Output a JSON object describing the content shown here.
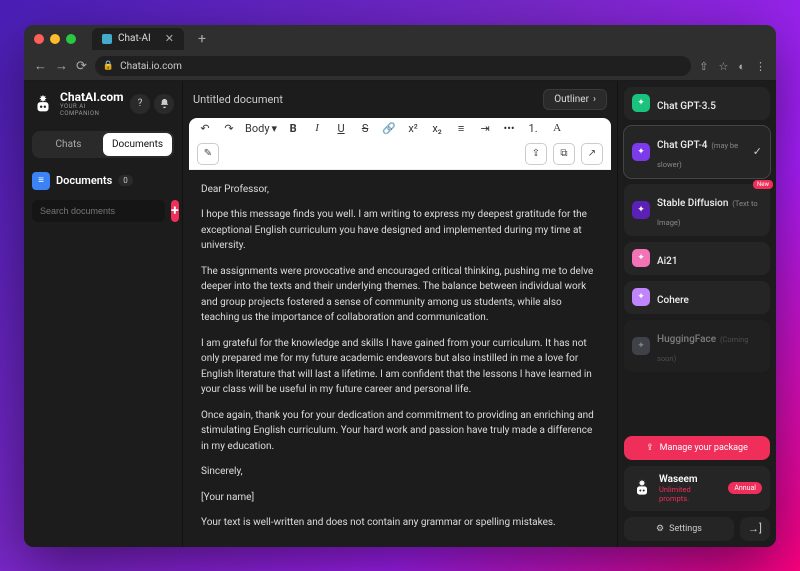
{
  "browser": {
    "tab_title": "Chat-AI",
    "url": "Chatai.io.com"
  },
  "brand": {
    "name": "ChatAI.com",
    "tagline": "YOUR AI COMPANION"
  },
  "sidebar": {
    "tabs": {
      "chats": "Chats",
      "documents": "Documents"
    },
    "section_title": "Documents",
    "doc_count": "0",
    "search_placeholder": "Search documents"
  },
  "doc": {
    "title": "Untitled document",
    "outliner_label": "Outliner",
    "body_style": "Body",
    "paragraphs": [
      "Dear Professor,",
      "I hope this message finds you well. I am writing to express my deepest gratitude for the exceptional English curriculum you have designed and implemented during my time at university.",
      "The assignments were provocative and encouraged critical thinking, pushing me to delve deeper into the texts and their underlying themes. The balance between individual work and group projects fostered a sense of community among us students, while also teaching us the importance of collaboration and communication.",
      "I am grateful for the knowledge and skills I have gained from your curriculum. It has not only prepared me for my future academic endeavors but also instilled in me a love for English literature that will last a lifetime. I am confident that the lessons I have learned in your class will be useful in my future career and personal life.",
      "Once again, thank you for your dedication and commitment to providing an enriching and stimulating English curriculum. Your hard work and passion have truly made a difference in my education.",
      "Sincerely,",
      "[Your name]",
      "Your text is well-written and does not contain any grammar or spelling mistakes."
    ]
  },
  "models": [
    {
      "name": "Chat GPT-3.5",
      "note": "",
      "color": "#19c37d",
      "selected": false,
      "faded": false,
      "badge": ""
    },
    {
      "name": "Chat GPT-4",
      "note": "(may be slower)",
      "color": "#7c3aed",
      "selected": true,
      "faded": false,
      "badge": ""
    },
    {
      "name": "Stable Diffusion",
      "note": "(Text to Image)",
      "color": "#5b21b6",
      "selected": false,
      "faded": false,
      "badge": "New"
    },
    {
      "name": "Ai21",
      "note": "",
      "color": "#f472b6",
      "selected": false,
      "faded": false,
      "badge": ""
    },
    {
      "name": "Cohere",
      "note": "",
      "color": "#c084fc",
      "selected": false,
      "faded": false,
      "badge": ""
    },
    {
      "name": "HuggingFace",
      "note": "(Coming soon)",
      "color": "#6b7280",
      "selected": false,
      "faded": true,
      "badge": ""
    }
  ],
  "footer": {
    "manage_label": "Manage your package",
    "user_name": "Waseem",
    "user_plan": "Unlimited prompts.",
    "plan_badge": "Annual",
    "settings_label": "Settings"
  }
}
